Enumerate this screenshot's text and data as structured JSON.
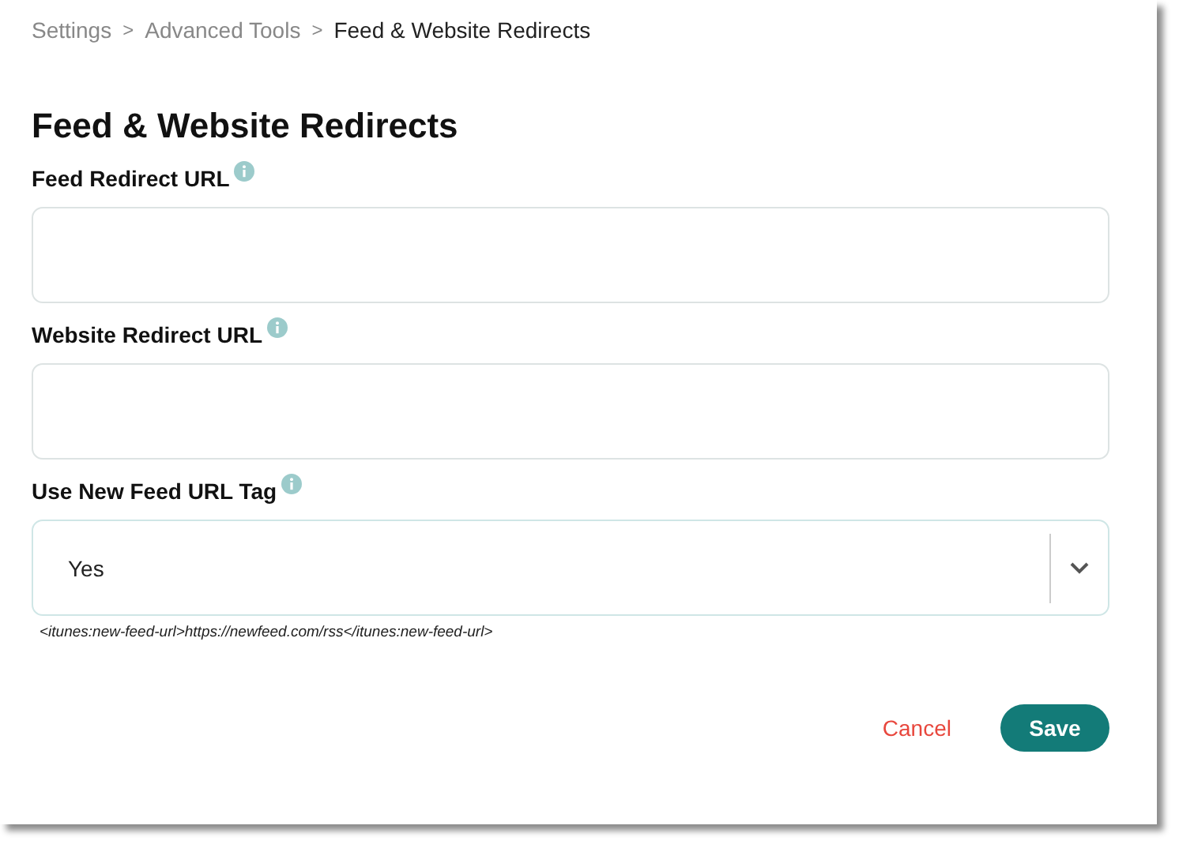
{
  "breadcrumb": [
    {
      "label": "Settings",
      "current": false
    },
    {
      "label": "Advanced Tools",
      "current": false
    },
    {
      "label": "Feed & Website Redirects",
      "current": true
    }
  ],
  "breadcrumb_separator": ">",
  "title": "Feed & Website Redirects",
  "fields": [
    {
      "kind": "text",
      "label": "Feed Redirect URL"
    },
    {
      "kind": "text",
      "label": "Website Redirect URL"
    },
    {
      "kind": "select",
      "label": "Use New Feed URL Tag",
      "value": "Yes",
      "hint": "<itunes:new-feed-url>https://newfeed.com/rss</itunes:new-feed-url>"
    }
  ],
  "buttons": {
    "cancel": "Cancel",
    "save": "Save"
  }
}
